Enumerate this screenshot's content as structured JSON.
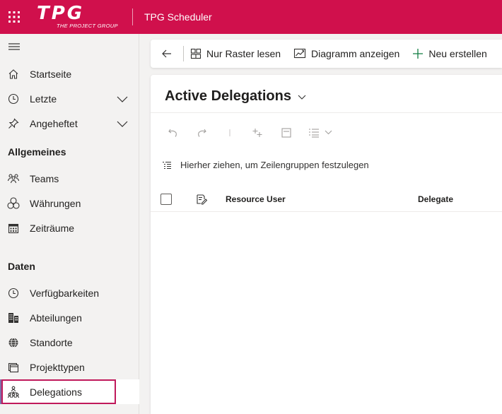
{
  "header": {
    "logo_text": "TPG",
    "logo_subtext": "THE PROJECT GROUP",
    "app_title": "TPG Scheduler",
    "brand_color": "#d0104c"
  },
  "sidebar": {
    "top_items": [
      {
        "label": "Startseite",
        "icon": "home-icon"
      },
      {
        "label": "Letzte",
        "icon": "clock-icon",
        "expandable": true
      },
      {
        "label": "Angeheftet",
        "icon": "pin-icon",
        "expandable": true
      }
    ],
    "groups": [
      {
        "title": "Allgemeines",
        "items": [
          {
            "label": "Teams",
            "icon": "people-icon"
          },
          {
            "label": "Währungen",
            "icon": "coins-icon"
          },
          {
            "label": "Zeiträume",
            "icon": "calendar-icon"
          }
        ]
      },
      {
        "title": "Daten",
        "items": [
          {
            "label": "Verfügbarkeiten",
            "icon": "clock-icon"
          },
          {
            "label": "Abteilungen",
            "icon": "building-icon"
          },
          {
            "label": "Standorte",
            "icon": "globe-icon"
          },
          {
            "label": "Projekttypen",
            "icon": "folder-icon"
          },
          {
            "label": "Delegations",
            "icon": "org-chart-icon",
            "selected": true
          }
        ]
      }
    ]
  },
  "commandbar": {
    "read_only_grid_label": "Nur Raster lesen",
    "show_chart_label": "Diagramm anzeigen",
    "new_label": "Neu erstellen"
  },
  "view": {
    "title": "Active Delegations",
    "group_hint": "Hierher ziehen, um Zeilengruppen festzulegen",
    "columns": [
      "Resource User",
      "Delegate"
    ]
  }
}
